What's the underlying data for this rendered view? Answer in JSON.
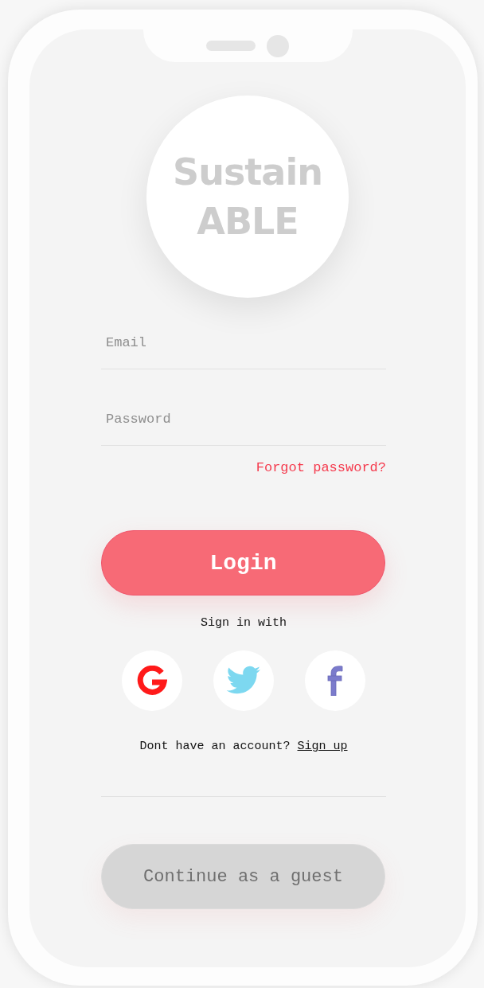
{
  "logo": {
    "lines": [
      "Sustain",
      "ABLE"
    ]
  },
  "fields": [
    {
      "placeholder": "Email"
    },
    {
      "placeholder": "Password"
    }
  ],
  "forgot_link": "Forgot password?",
  "login_button": {
    "label": "Login",
    "disabled": false
  },
  "social": {
    "label": "Sign in with",
    "buttons": [
      {
        "kind": "g"
      },
      {
        "kind": "bird"
      },
      {
        "kind": "f"
      }
    ]
  },
  "signup": {
    "prompt": "Dont have an account?",
    "link": "Sign up"
  },
  "guest_button": {
    "label": "Continue as a guest",
    "disabled": true
  }
}
